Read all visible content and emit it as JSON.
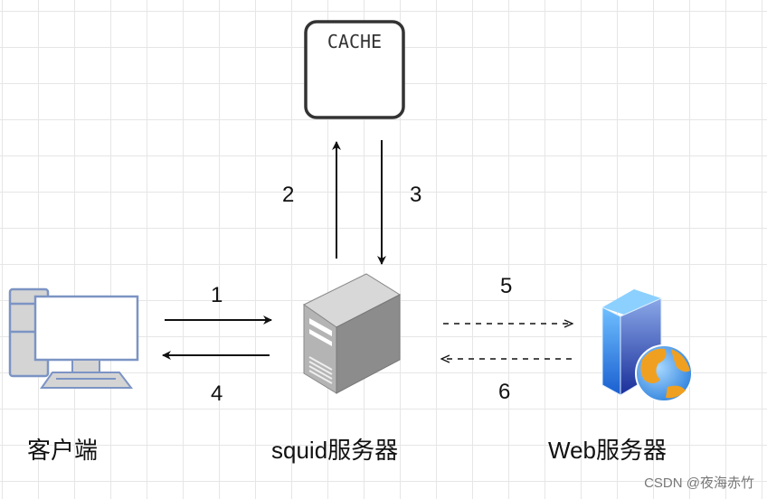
{
  "nodes": {
    "cache": "CACHE",
    "client": "客户端",
    "squid": "squid服务器",
    "web": "Web服务器"
  },
  "edges": {
    "e1": "1",
    "e2": "2",
    "e3": "3",
    "e4": "4",
    "e5": "5",
    "e6": "6"
  },
  "watermark": "CSDN @夜海赤竹"
}
